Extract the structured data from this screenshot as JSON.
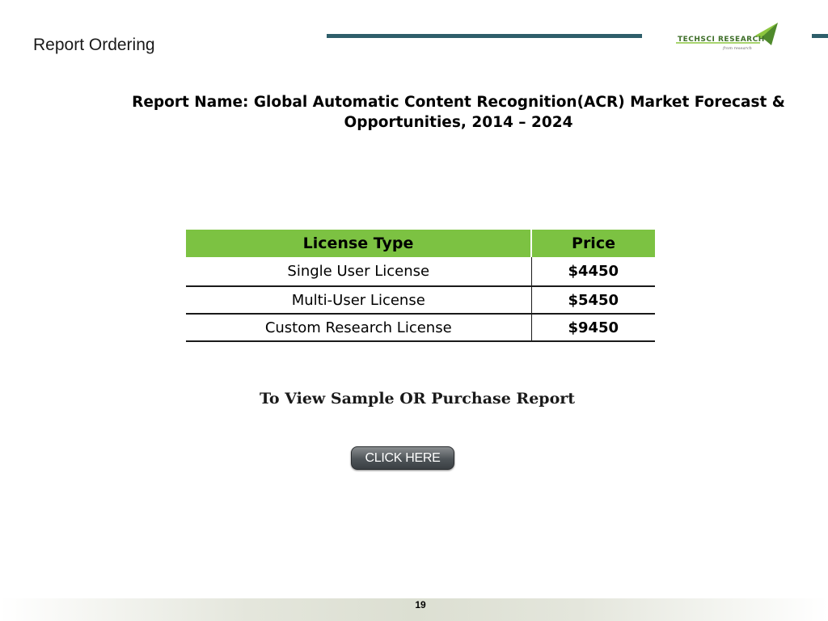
{
  "header": {
    "section_title": "Report Ordering",
    "logo_text": "TECHSCI RESEARCH",
    "logo_tagline": "from research"
  },
  "report": {
    "name_line1": "Report Name: Global Automatic Content Recognition(ACR) Market Forecast &",
    "name_line2": "Opportunities, 2014 – 2024"
  },
  "license_table": {
    "headers": [
      "License Type",
      "Price"
    ],
    "rows": [
      {
        "type": "Single User License",
        "price": "$4450"
      },
      {
        "type": "Multi-User License",
        "price": "$5450"
      },
      {
        "type": "Custom Research License",
        "price": "$9450"
      }
    ]
  },
  "cta": {
    "text": "To View Sample OR Purchase Report",
    "button_label": "CLICK HERE"
  },
  "footer": {
    "page_number": "19"
  },
  "colors": {
    "header_rule": "#2e5e6a",
    "table_header": "#7cc242",
    "button": "#4e5458"
  }
}
